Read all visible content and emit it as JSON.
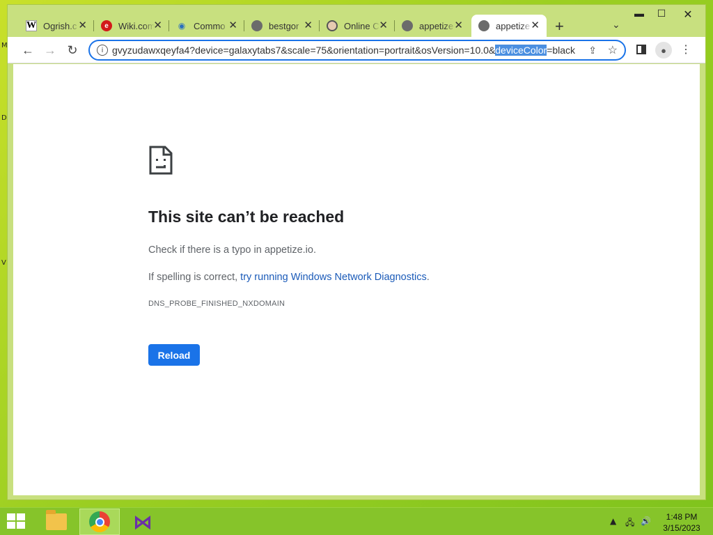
{
  "desktop": {
    "edge_letters": [
      "M",
      "D",
      "V"
    ]
  },
  "tabs": [
    {
      "title": "Ogrish.c",
      "favicon": "wikipedia-w-icon"
    },
    {
      "title": "Wiki.com",
      "favicon": "wiki-com-icon"
    },
    {
      "title": "Commo",
      "favicon": "commons-drop-icon"
    },
    {
      "title": "bestgor",
      "favicon": "globe-icon"
    },
    {
      "title": "Online C",
      "favicon": "person-icon"
    },
    {
      "title": "appetize",
      "favicon": "globe-icon"
    },
    {
      "title": "appetize",
      "favicon": "globe-icon",
      "active": true
    }
  ],
  "omnibox": {
    "url_before": "gvyzudawxqeyfa4?device=galaxytabs7&scale=75&orientation=portrait&osVersion=10.0&",
    "url_selected": "deviceColor",
    "url_after": "=black"
  },
  "error": {
    "title": "This site can’t be reached",
    "line1": "Check if there is a typo in appetize.io.",
    "line2_prefix": "If spelling is correct, ",
    "line2_link": "try running Windows Network Diagnostics",
    "line2_suffix": ".",
    "code": "DNS_PROBE_FINISHED_NXDOMAIN",
    "reload_label": "Reload"
  },
  "taskbar": {
    "time": "1:48 PM",
    "date": "3/15/2023"
  },
  "colors": {
    "accent": "#1a73e8",
    "link": "#1a5ab8",
    "desktop": "#9ccf22"
  }
}
